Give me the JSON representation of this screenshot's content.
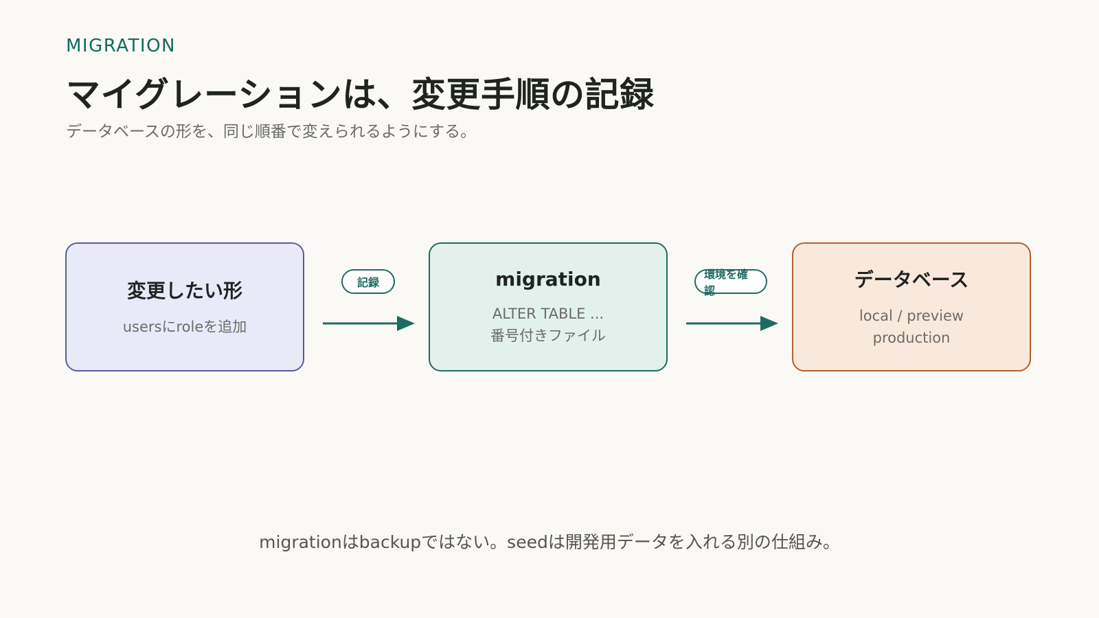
{
  "header": {
    "eyebrow": "MIGRATION",
    "title": "マイグレーションは、変更手順の記録",
    "subtitle": "データベースの形を、同じ順番で変えられるようにする。"
  },
  "flow": {
    "nodes": [
      {
        "title": "変更したい形",
        "lines": [
          "usersにroleを追加"
        ],
        "fill": "#e9eaf8",
        "border": "#575c9a"
      },
      {
        "title": "migration",
        "lines": [
          "ALTER TABLE ...",
          "番号付きファイル"
        ],
        "fill": "#e2f1ec",
        "border": "#1d6b62"
      },
      {
        "title": "データベース",
        "lines": [
          "local / preview",
          "production"
        ],
        "fill": "#f9e9dc",
        "border": "#b35f2c"
      }
    ],
    "edges": [
      {
        "label": "記録"
      },
      {
        "label": "環境を確認"
      }
    ],
    "accent_color": "#1d6b62"
  },
  "footer": {
    "note": "migrationはbackupではない。seedは開発用データを入れる別の仕組み。"
  }
}
